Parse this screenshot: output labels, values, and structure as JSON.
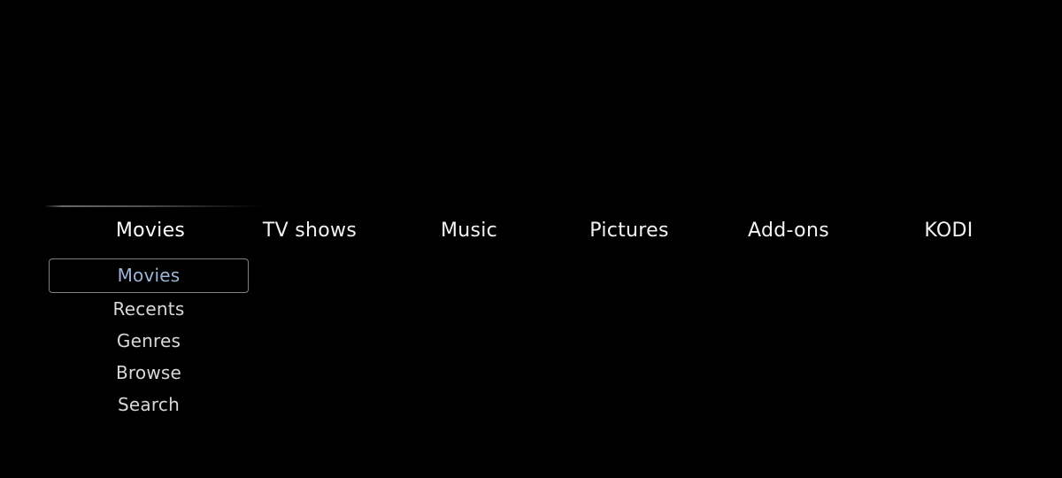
{
  "app": {
    "name": "KODI",
    "theme_background": "#000000",
    "accent_selected_text": "#9db4d6",
    "primary_text": "#f2f2f2",
    "secondary_text": "#d6d8da",
    "selection_border": "#7d8184"
  },
  "main_menu": {
    "selected_index": 0,
    "items": [
      {
        "label": "Movies"
      },
      {
        "label": "TV shows"
      },
      {
        "label": "Music"
      },
      {
        "label": "Pictures"
      },
      {
        "label": "Add-ons"
      },
      {
        "label": "KODI"
      }
    ]
  },
  "submenu": {
    "parent": "Movies",
    "selected_index": 0,
    "items": [
      {
        "label": "Movies"
      },
      {
        "label": "Recents"
      },
      {
        "label": "Genres"
      },
      {
        "label": "Browse"
      },
      {
        "label": "Search"
      }
    ]
  }
}
